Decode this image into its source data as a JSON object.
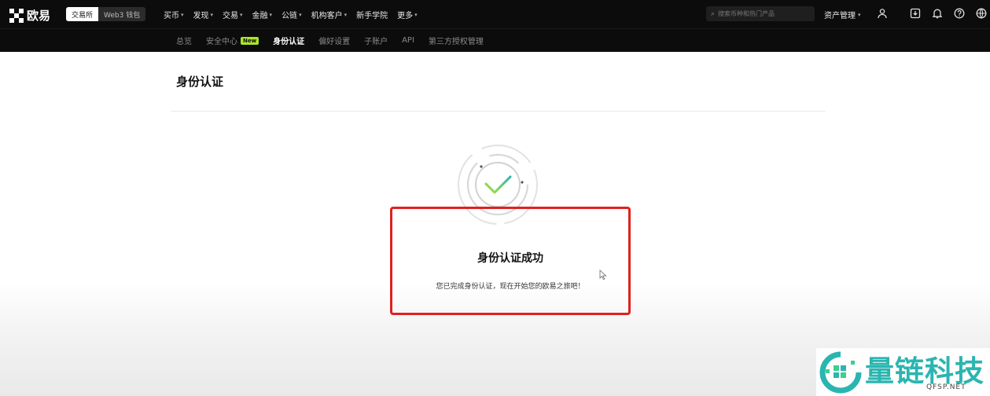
{
  "header": {
    "brand": "欧易",
    "mode_tabs": [
      "交易所",
      "Web3 钱包"
    ],
    "nav": [
      {
        "label": "买币",
        "dropdown": true
      },
      {
        "label": "发现",
        "dropdown": true
      },
      {
        "label": "交易",
        "dropdown": true
      },
      {
        "label": "金融",
        "dropdown": true
      },
      {
        "label": "公链",
        "dropdown": true
      },
      {
        "label": "机构客户",
        "dropdown": true
      },
      {
        "label": "新手学院",
        "dropdown": false
      },
      {
        "label": "更多",
        "dropdown": true
      }
    ],
    "search_placeholder": "搜索币种和热门产品",
    "assets_label": "资产管理",
    "icons": [
      "user-icon",
      "download-icon",
      "bell-icon",
      "help-icon",
      "globe-icon"
    ]
  },
  "subnav": {
    "tabs": [
      {
        "label": "总览"
      },
      {
        "label": "安全中心",
        "badge": "New"
      },
      {
        "label": "身份认证",
        "active": true
      },
      {
        "label": "偏好设置"
      },
      {
        "label": "子账户"
      },
      {
        "label": "API"
      },
      {
        "label": "第三方授权管理"
      }
    ]
  },
  "main": {
    "title": "身份认证",
    "success_title": "身份认证成功",
    "success_desc": "您已完成身份认证，现在开始您的欧易之旅吧！"
  },
  "watermark": {
    "text": "量链科技",
    "sub": "QFSP.NET"
  },
  "colors": {
    "accent_green": "#a9e32b",
    "highlight_red": "#e02020",
    "watermark_teal": "#2bb5b0"
  }
}
